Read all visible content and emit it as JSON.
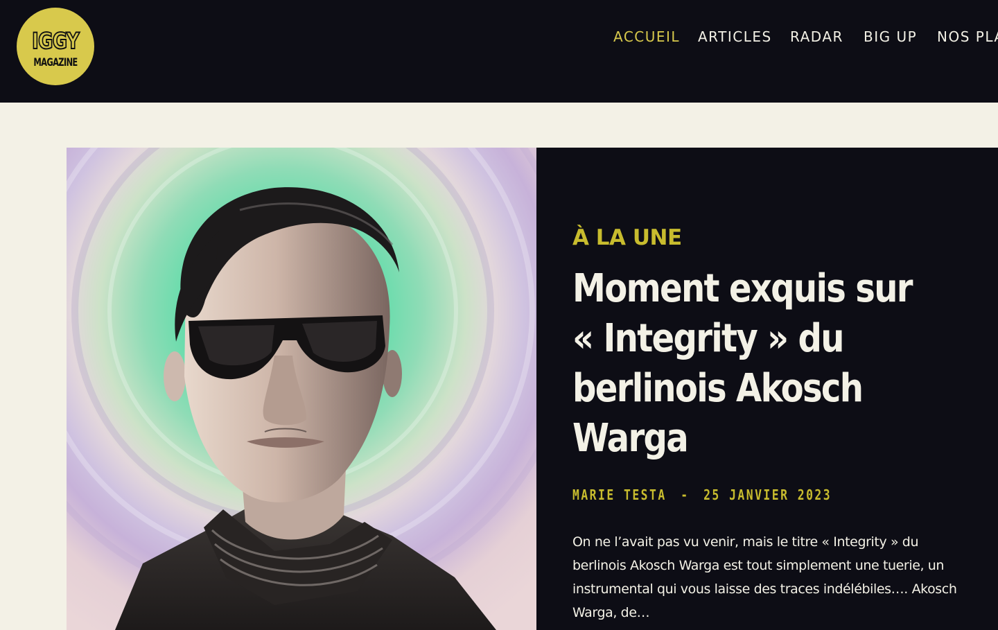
{
  "brand": {
    "logo_top": "IGGY",
    "logo_bottom": "MAGAZINE",
    "logo_color": "#d8c94c"
  },
  "nav": {
    "items": [
      {
        "label": "ACCUEIL",
        "active": true
      },
      {
        "label": "ARTICLES",
        "active": false
      },
      {
        "label": "RADAR",
        "active": false
      },
      {
        "label": "BIG UP",
        "active": false
      },
      {
        "label": "NOS PLA",
        "active": false
      }
    ]
  },
  "featured": {
    "kicker": "À LA UNE",
    "title": "Moment exquis sur « Integrity » du berlinois Akosch Warga",
    "author": "MARIE TESTA",
    "separator": "-",
    "date": "25 JANVIER 2023",
    "excerpt": "On ne l’avait pas vu venir, mais le titre  « Integrity » du berlinois Akosch Warga est tout simplement une tuerie, un instrumental qui vous laisse des traces indélébiles…. Akosch Warga, de…",
    "image_icon": "portrait-illustration"
  },
  "colors": {
    "header_bg": "#0d0d15",
    "page_bg": "#f3f1e6",
    "accent": "#c8bc2e",
    "text_light": "#f3f1e6"
  }
}
